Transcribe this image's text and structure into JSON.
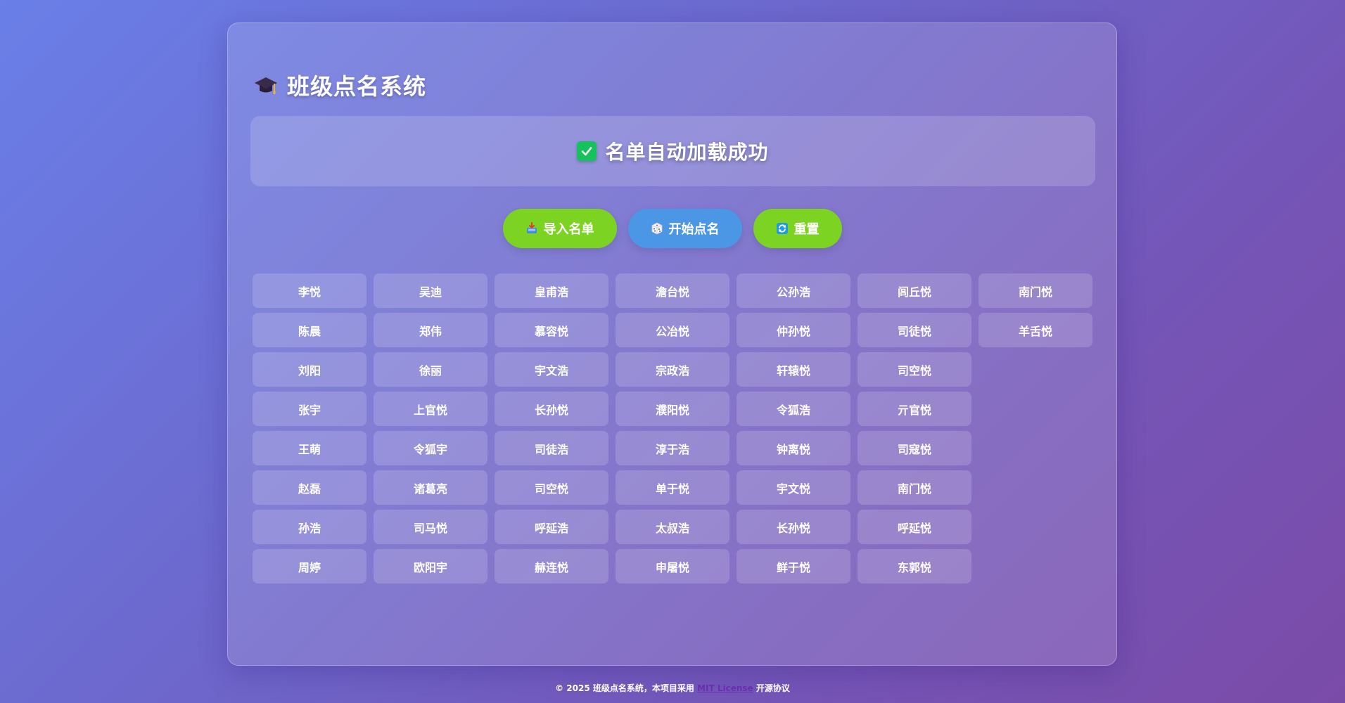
{
  "title": "班级点名系统",
  "title_icon": "graduation-cap-icon",
  "status": {
    "icon": "check-box-icon",
    "text": "名单自动加载成功"
  },
  "buttons": [
    {
      "label": "导入名单",
      "icon": "inbox-tray-icon",
      "color": "#7dd321"
    },
    {
      "label": "开始点名",
      "icon": "dice-icon",
      "color": "#4b97e6"
    },
    {
      "label": "重置",
      "icon": "refresh-icon",
      "color": "#7dd321"
    }
  ],
  "students": [
    [
      "李悦",
      "吴迪",
      "皇甫浩",
      "澹台悦",
      "公孙浩",
      "闾丘悦",
      "南门悦"
    ],
    [
      "陈晨",
      "郑伟",
      "慕容悦",
      "公冶悦",
      "仲孙悦",
      "司徒悦",
      "羊舌悦"
    ],
    [
      "刘阳",
      "徐丽",
      "宇文浩",
      "宗政浩",
      "轩辕悦",
      "司空悦"
    ],
    [
      "张宇",
      "上官悦",
      "长孙悦",
      "濮阳悦",
      "令狐浩",
      "亓官悦"
    ],
    [
      "王萌",
      "令狐宇",
      "司徒浩",
      "淳于浩",
      "钟离悦",
      "司寇悦"
    ],
    [
      "赵磊",
      "诸葛亮",
      "司空悦",
      "单于悦",
      "宇文悦",
      "南门悦"
    ],
    [
      "孙浩",
      "司马悦",
      "呼延浩",
      "太叔浩",
      "长孙悦",
      "呼延悦"
    ],
    [
      "周婷",
      "欧阳宇",
      "赫连悦",
      "申屠悦",
      "鲜于悦",
      "东郭悦"
    ]
  ],
  "footer": {
    "prefix": "© 2025 班级点名系统，本项目采用",
    "link": "MIT License",
    "suffix": "开源协议"
  }
}
